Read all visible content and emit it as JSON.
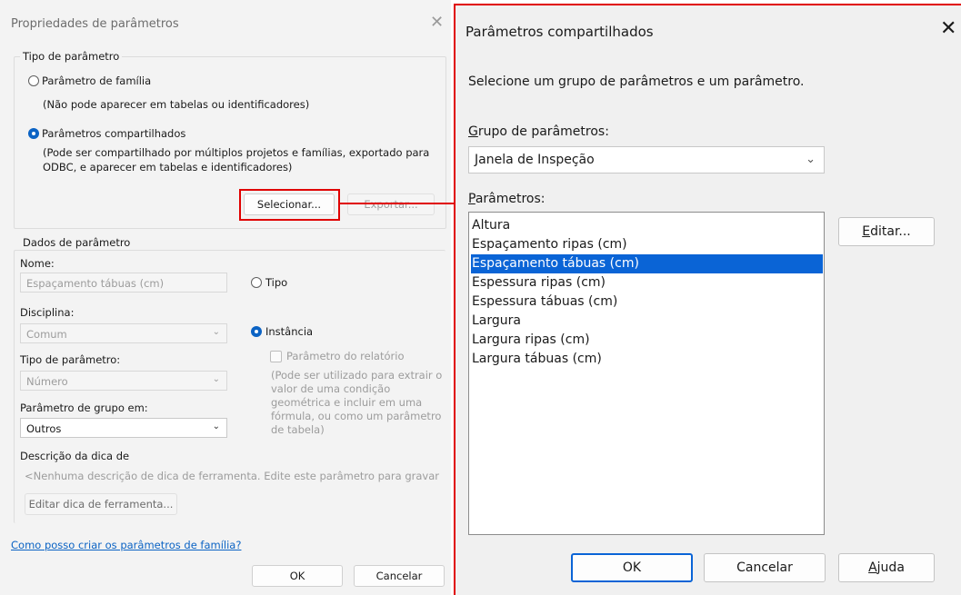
{
  "left_dialog": {
    "title": "Propriedades de parâmetros",
    "close_glyph": "✕",
    "param_type_group": {
      "legend": "Tipo de parâmetro",
      "family_radio": {
        "label": "Parâmetro de família",
        "note": "(Não pode aparecer em tabelas ou identificadores)",
        "selected": false
      },
      "shared_radio": {
        "label": "Parâmetros compartilhados",
        "note_line1": "(Pode ser compartilhado por múltiplos projetos e famílias, exportado para",
        "note_line2": "ODBC, e aparecer em tabelas e identificadores)",
        "selected": true
      },
      "select_button": "Selecionar...",
      "export_button": "Exportar..."
    },
    "param_data_group": {
      "legend": "Dados de parâmetro",
      "name_label": "Nome:",
      "name_value": "Espaçamento tábuas (cm)",
      "type_radio": "Tipo",
      "discipline_label": "Disciplina:",
      "discipline_value": "Comum",
      "instance_radio": "Instância",
      "param_type_label": "Tipo de parâmetro:",
      "param_type_value": "Número",
      "report_checkbox": "Parâmetro do relatório",
      "report_note": [
        "(Pode ser utilizado para extrair o",
        "valor de uma condição",
        "geométrica e incluir em uma",
        "fórmula, ou como um parâmetro",
        "de tabela)"
      ],
      "group_label": "Parâmetro de grupo em:",
      "group_value": "Outros",
      "tooltip_label": "Descrição da dica de",
      "tooltip_placeholder": "<Nenhuma descrição de dica de ferramenta. Edite este parâmetro para gravar",
      "edit_tooltip_button": "Editar dica de ferramenta..."
    },
    "help_link": "Como posso criar os parâmetros de família?",
    "ok_button": "OK",
    "cancel_button": "Cancelar"
  },
  "right_dialog": {
    "title": "Parâmetros compartilhados",
    "close_glyph": "✕",
    "instruction": "Selecione um grupo de parâmetros e um parâmetro.",
    "group_label_first": "G",
    "group_label_rest": "rupo de parâmetros:",
    "group_value": "Janela de Inspeção",
    "params_label_first": "P",
    "params_label_rest": "arâmetros:",
    "parameters": [
      "Altura",
      "Espaçamento ripas (cm)",
      "Espaçamento tábuas (cm)",
      "Espessura ripas (cm)",
      "Espessura tábuas (cm)",
      "Largura",
      "Largura ripas (cm)",
      "Largura tábuas (cm)"
    ],
    "selected_index": 2,
    "edit_button_first": "E",
    "edit_button_rest": "ditar...",
    "ok_button": "OK",
    "cancel_button": "Cancelar",
    "help_button_first": "A",
    "help_button_rest": "juda"
  },
  "colors": {
    "highlight_red": "#e00000",
    "accent_blue": "#0a64d6",
    "link_blue": "#0b63c4"
  }
}
